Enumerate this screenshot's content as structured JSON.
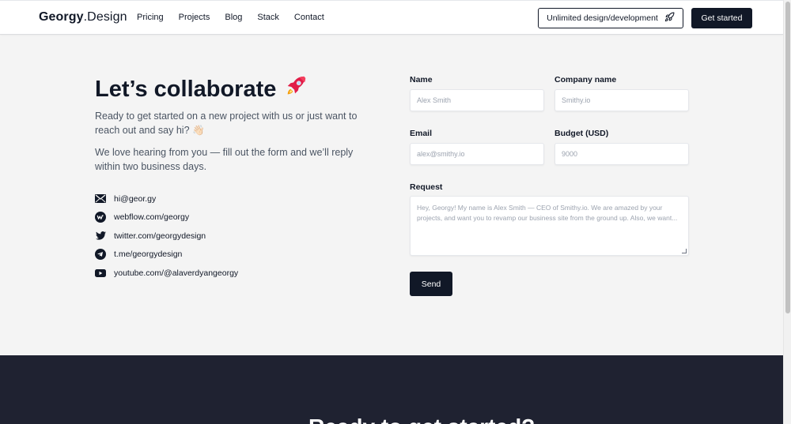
{
  "header": {
    "logo_main": "Georgy",
    "logo_dot": ".Design",
    "nav": [
      "Pricing",
      "Projects",
      "Blog",
      "Stack",
      "Contact"
    ],
    "cta_outline": "Unlimited design/development",
    "cta_primary": "Get started"
  },
  "hero": {
    "title": "Let’s collaborate",
    "paragraph1": "Ready to get started on a new project with us or just want to reach out and say hi? 👋🏻",
    "paragraph2": "We love hearing from you — fill out the form and we’ll reply within two business days."
  },
  "contacts": [
    {
      "icon": "email-icon",
      "text": "hi@geor.gy"
    },
    {
      "icon": "webflow-icon",
      "text": "webflow.com/georgy"
    },
    {
      "icon": "twitter-icon",
      "text": "twitter.com/georgydesign"
    },
    {
      "icon": "telegram-icon",
      "text": "t.me/georgydesign"
    },
    {
      "icon": "youtube-icon",
      "text": "youtube.com/@alaverdyangeorgy"
    }
  ],
  "form": {
    "name_label": "Name",
    "name_placeholder": "Alex Smith",
    "company_label": "Company name",
    "company_placeholder": "Smithy.io",
    "email_label": "Email",
    "email_placeholder": "alex@smithy.io",
    "budget_label": "Budget (USD)",
    "budget_placeholder": "9000",
    "request_label": "Request",
    "request_placeholder": "Hey, Georgy! My name is Alex Smith — CEO of Smithy.io. We are amazed by your projects, and want you to revamp our business site from the ground up. Also, we want...",
    "send_label": "Send"
  },
  "footer": {
    "teaser": "Ready to get started?"
  },
  "colors": {
    "dark": "#111827",
    "background": "#f4f4f4",
    "band": "#1f2231"
  }
}
